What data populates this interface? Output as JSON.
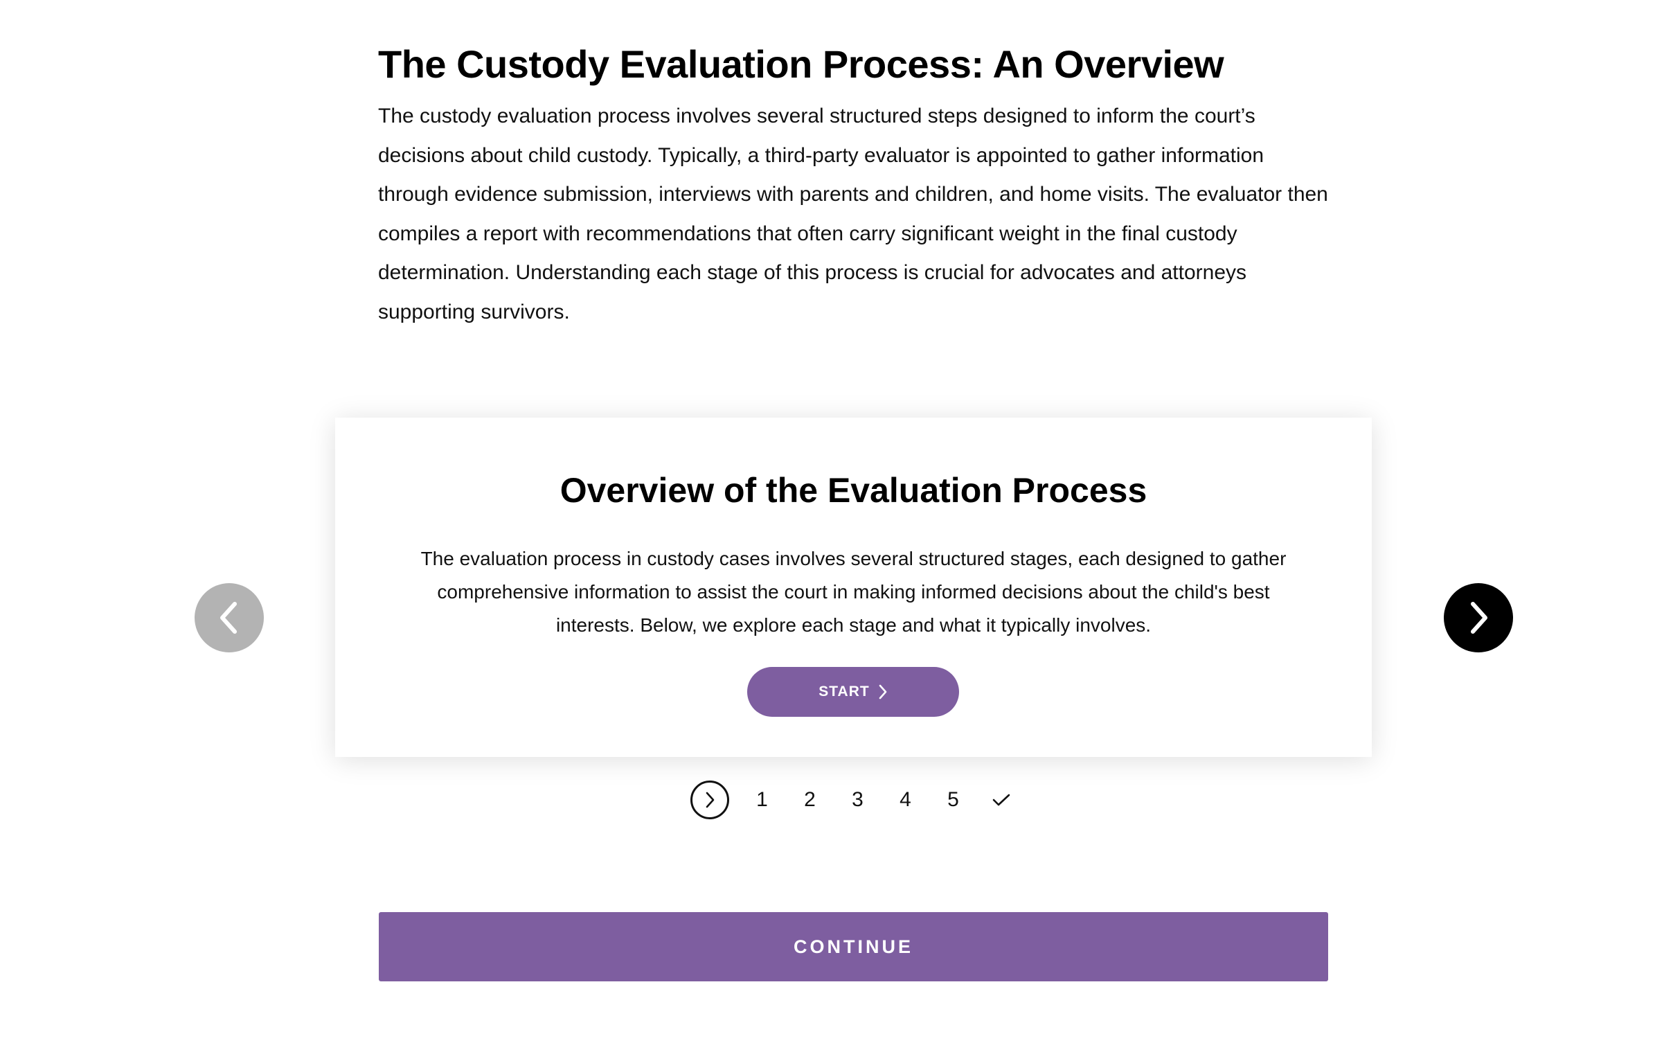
{
  "intro": {
    "title": "The Custody Evaluation Process: An Overview",
    "body": "The custody evaluation process involves several structured steps designed to inform the court’s decisions about child custody. Typically, a third-party evaluator is appointed to gather information through evidence submission, interviews with parents and children, and home visits. The evaluator then compiles a report with recommendations that often carry significant weight in the final custody determination. Understanding each stage of this process is crucial for advocates and attorneys supporting survivors."
  },
  "card": {
    "title": "Overview of the Evaluation Process",
    "body": "The evaluation process in custody cases involves several structured stages, each designed to gather comprehensive information to assist the court in making informed decisions about the child's best interests. Below, we explore each stage and what it typically involves.",
    "start_label": "START"
  },
  "carousel": {
    "prev_icon": "chevron-left-icon",
    "next_icon": "chevron-right-icon",
    "prev_color": "#b3b3b3",
    "next_color": "#000000"
  },
  "pager": {
    "current_icon": "chevron-right-icon",
    "pages": [
      "1",
      "2",
      "3",
      "4",
      "5"
    ],
    "final_icon": "checkmark-icon"
  },
  "footer": {
    "continue_label": "CONTINUE"
  },
  "colors": {
    "accent": "#7e5ea0",
    "text": "#111111",
    "background": "#ffffff"
  }
}
